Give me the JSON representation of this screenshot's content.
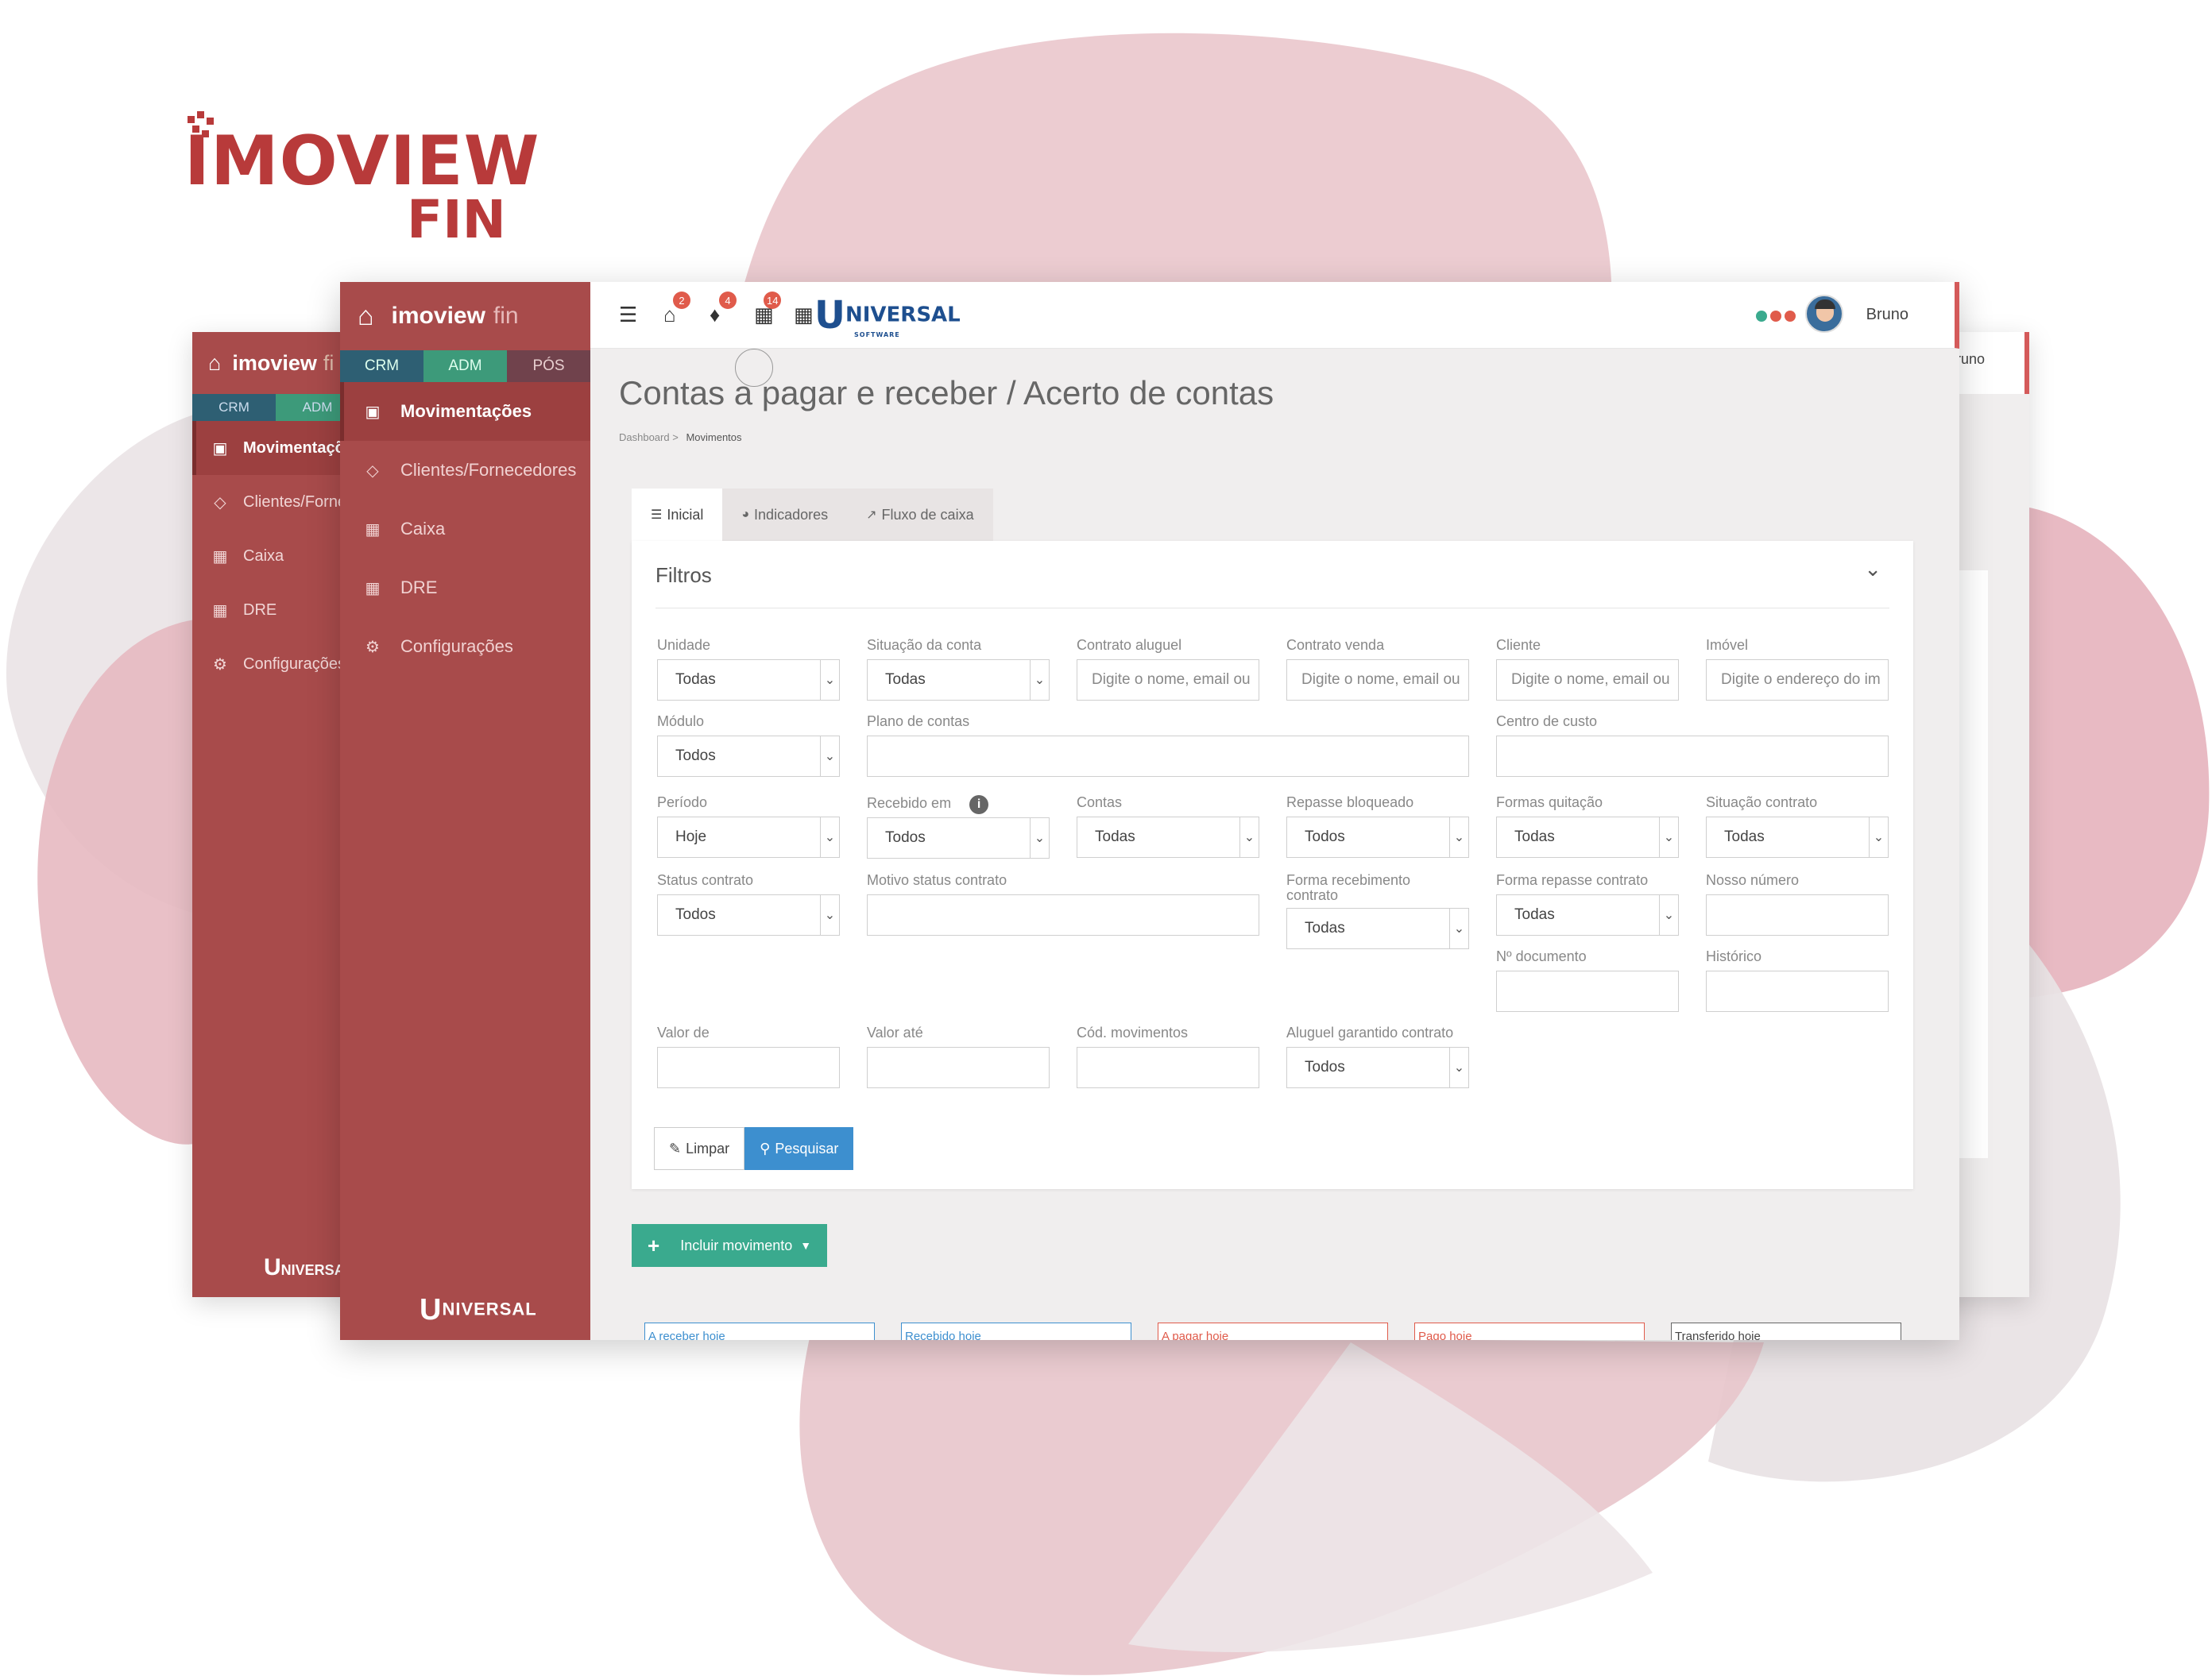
{
  "brand": {
    "name": "IMOVIEW",
    "sub": "FIN"
  },
  "colors": {
    "sidebar": "#a84b4b",
    "crm": "#2e5f73",
    "adm": "#3d9a7a",
    "primary": "#3d8fcf",
    "success": "#3aaa8e",
    "danger": "#e05b4b"
  },
  "back_window": {
    "app_name": "imoview",
    "app_suffix": "fi",
    "tabs": [
      "CRM",
      "ADM"
    ],
    "menu": [
      {
        "label": "Movimentaçõ",
        "icon": "money-icon"
      },
      {
        "label": "Clientes/Forne",
        "icon": "diamond-icon"
      },
      {
        "label": "Caixa",
        "icon": "calculator-icon"
      },
      {
        "label": "DRE",
        "icon": "table-icon"
      },
      {
        "label": "Configurações",
        "icon": "gears-icon"
      }
    ],
    "logo": "NIVERSA",
    "user": "runo"
  },
  "sidebar": {
    "app_name": "imoview",
    "app_suffix": "fin",
    "tabs": {
      "crm": "CRM",
      "adm": "ADM",
      "pos": "PÓS"
    },
    "menu": [
      {
        "label": "Movimentações",
        "icon": "money-icon"
      },
      {
        "label": "Clientes/Fornecedores",
        "icon": "diamond-icon"
      },
      {
        "label": "Caixa",
        "icon": "calculator-icon"
      },
      {
        "label": "DRE",
        "icon": "table-icon"
      },
      {
        "label": "Configurações",
        "icon": "gears-icon"
      }
    ],
    "logo": "NIVERSAL"
  },
  "topbar": {
    "badges": {
      "home": "2",
      "bell": "4",
      "calendar": "14"
    },
    "logo_text": "NIVERSAL",
    "logo_sub": "SOFTWARE",
    "user_name": "Bruno"
  },
  "page": {
    "title": "Contas a pagar e receber / Acerto de contas",
    "breadcrumb": [
      "Dashboard",
      "Movimentos"
    ]
  },
  "tabs": [
    "Inicial",
    "Indicadores",
    "Fluxo de caixa"
  ],
  "filters": {
    "title": "Filtros",
    "unidade": {
      "label": "Unidade",
      "value": "Todas"
    },
    "situacao_conta": {
      "label": "Situação da conta",
      "value": "Todas"
    },
    "contrato_aluguel": {
      "label": "Contrato aluguel",
      "placeholder": "Digite o nome, email ou"
    },
    "contrato_venda": {
      "label": "Contrato venda",
      "placeholder": "Digite o nome, email ou"
    },
    "cliente": {
      "label": "Cliente",
      "placeholder": "Digite o nome, email ou"
    },
    "imovel": {
      "label": "Imóvel",
      "placeholder": "Digite o endereço do im"
    },
    "modulo": {
      "label": "Módulo",
      "value": "Todos"
    },
    "plano_contas": {
      "label": "Plano de contas"
    },
    "centro_custo": {
      "label": "Centro de custo"
    },
    "periodo": {
      "label": "Período",
      "value": "Hoje"
    },
    "recebido_em": {
      "label": "Recebido em",
      "value": "Todos"
    },
    "contas": {
      "label": "Contas",
      "value": "Todas"
    },
    "repasse_bloqueado": {
      "label": "Repasse bloqueado",
      "value": "Todos"
    },
    "formas_quitacao": {
      "label": "Formas quitação",
      "value": "Todas"
    },
    "situacao_contrato": {
      "label": "Situação contrato",
      "value": "Todas"
    },
    "status_contrato": {
      "label": "Status contrato",
      "value": "Todos"
    },
    "motivo_status": {
      "label": "Motivo status contrato"
    },
    "forma_recebimento": {
      "label": "Forma recebimento contrato",
      "value": "Todas"
    },
    "forma_repasse": {
      "label": "Forma repasse contrato",
      "value": "Todas"
    },
    "nosso_numero": {
      "label": "Nosso número"
    },
    "n_documento": {
      "label": "Nº documento"
    },
    "historico": {
      "label": "Histórico"
    },
    "valor_de": {
      "label": "Valor de"
    },
    "valor_ate": {
      "label": "Valor até"
    },
    "cod_movimentos": {
      "label": "Cód. movimentos"
    },
    "aluguel_garantido": {
      "label": "Aluguel garantido contrato",
      "value": "Todos"
    }
  },
  "buttons": {
    "clear": "Limpar",
    "search": "Pesquisar",
    "add": "Incluir movimento"
  },
  "cards": [
    {
      "label": "A receber hoje",
      "color": "#3d8fcf"
    },
    {
      "label": "Recebido hoje",
      "color": "#3d8fcf"
    },
    {
      "label": "A pagar hoje",
      "color": "#e05b4b"
    },
    {
      "label": "Pago hoje",
      "color": "#e05b4b"
    },
    {
      "label": "Transferido hoje",
      "color": "#666666"
    }
  ]
}
